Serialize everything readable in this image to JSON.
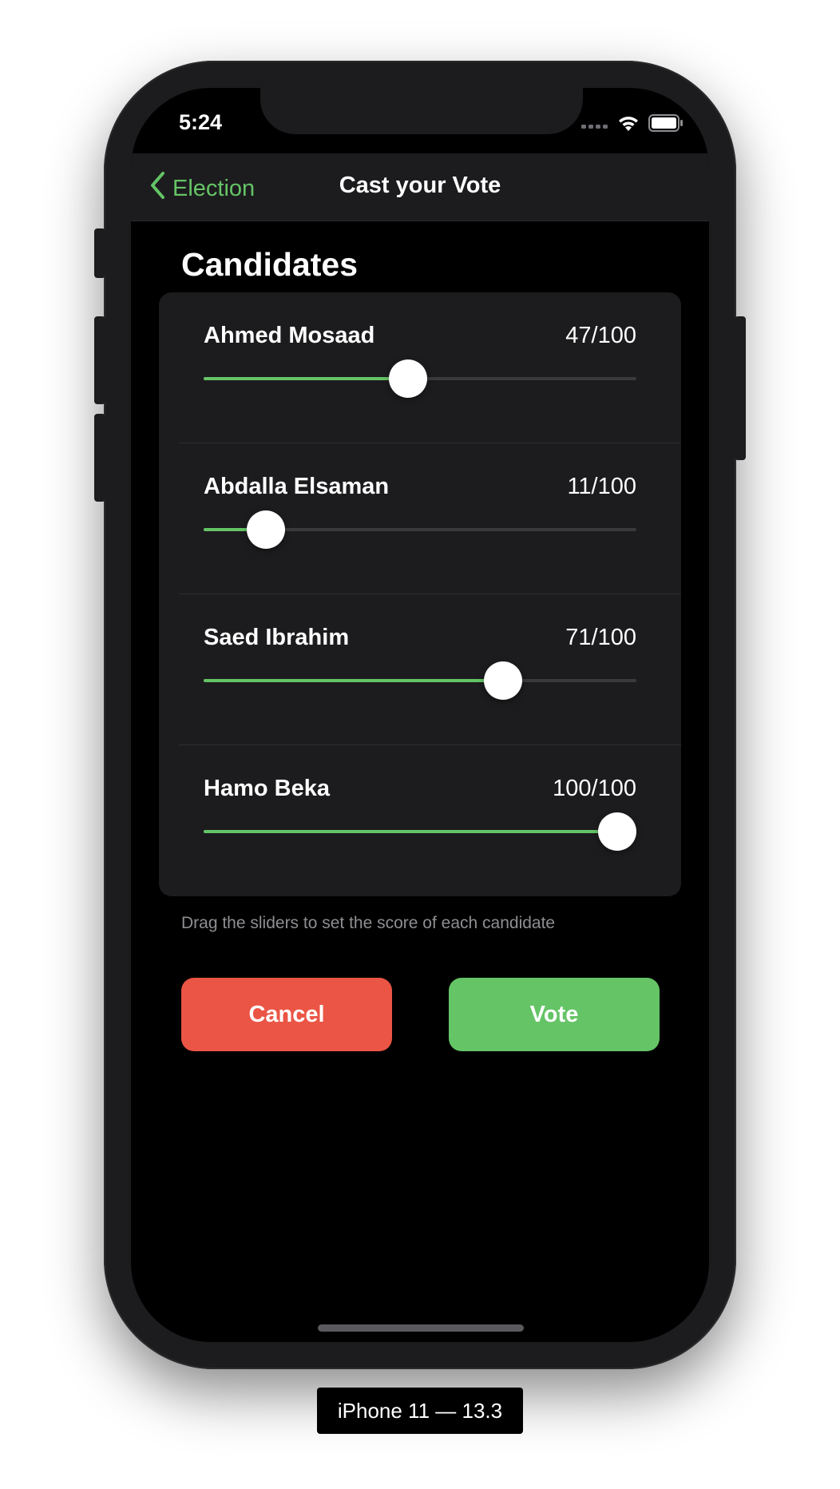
{
  "status_bar": {
    "time": "5:24",
    "icons": [
      "cellular-signal-icon",
      "wifi-icon",
      "battery-icon"
    ]
  },
  "nav": {
    "back_label": "Election",
    "title": "Cast your Vote"
  },
  "section_title": "Candidates",
  "candidates": [
    {
      "name": "Ahmed Mosaad",
      "score_text": "47/100",
      "score": 47,
      "max": 100
    },
    {
      "name": "Abdalla Elsaman",
      "score_text": "11/100",
      "score": 11,
      "max": 100
    },
    {
      "name": "Saed Ibrahim",
      "score_text": "71/100",
      "score": 71,
      "max": 100
    },
    {
      "name": "Hamo Beka",
      "score_text": "100/100",
      "score": 100,
      "max": 100
    }
  ],
  "hint": "Drag the sliders to set the score of each candidate",
  "buttons": {
    "cancel_label": "Cancel",
    "vote_label": "Vote"
  },
  "device_label": "iPhone 11 — 13.3",
  "colors": {
    "accent": "#65c466",
    "cancel": "#eb5545",
    "background": "#000000",
    "card": "#1c1c1e"
  }
}
